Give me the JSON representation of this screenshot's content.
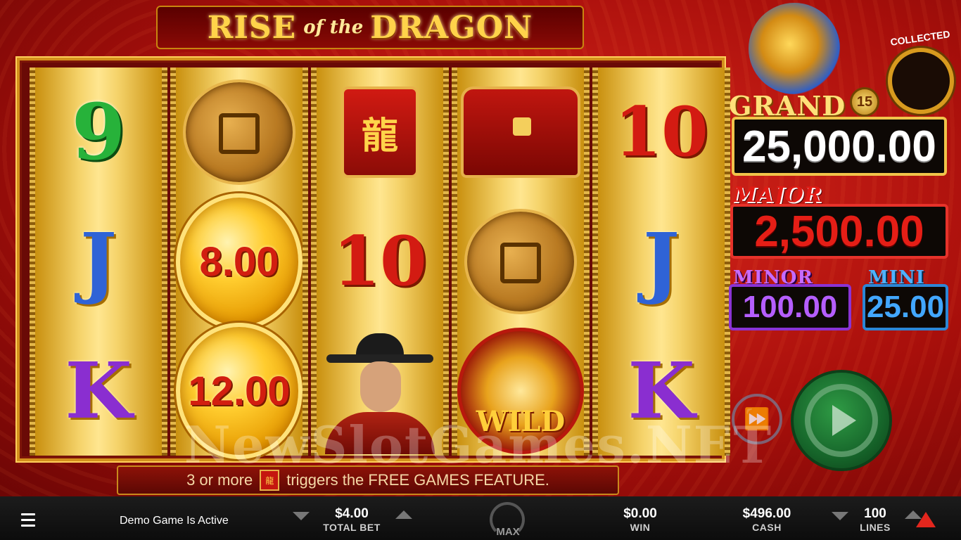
{
  "game": {
    "title_word_1": "RISE",
    "title_word_2": "of the",
    "title_word_3": "DRAGON"
  },
  "reels": [
    [
      "9",
      "J",
      "K"
    ],
    [
      "coins",
      "8.00",
      "12.00"
    ],
    [
      "banner",
      "10",
      "official"
    ],
    [
      "chest",
      "coins",
      "WILD"
    ],
    [
      "10",
      "J",
      "K"
    ]
  ],
  "symbols": {
    "banner_char": "龍",
    "wild_text": "WILD",
    "coin_1": "8.00",
    "coin_2": "12.00"
  },
  "jackpots": {
    "collected_label": "COLLECTED",
    "grand_label": "GRAND",
    "grand_badge": "15",
    "grand_value": "25,000.00",
    "major_label": "MAJOR",
    "major_value": "2,500.00",
    "minor_label": "MINOR",
    "minor_value": "100.00",
    "mini_label": "MINI",
    "mini_value": "25.00"
  },
  "info": {
    "prefix": "3  or more",
    "suffix": "triggers the FREE GAMES FEATURE."
  },
  "watermark": "NewSlotGames.NET",
  "bottom_bar": {
    "demo_text": "Demo Game Is Active",
    "total_bet_value": "$4.00",
    "total_bet_label": "TOTAL BET",
    "max_label": "MAX",
    "win_value": "$0.00",
    "win_label": "WIN",
    "cash_value": "$496.00",
    "cash_label": "CASH",
    "lines_value": "100",
    "lines_label": "LINES"
  },
  "colors": {
    "background": "#b3130d",
    "grand": "#ffe079",
    "major": "#e51e16",
    "minor": "#b55eff",
    "mini": "#42a7ff",
    "spin": "#16652a"
  }
}
